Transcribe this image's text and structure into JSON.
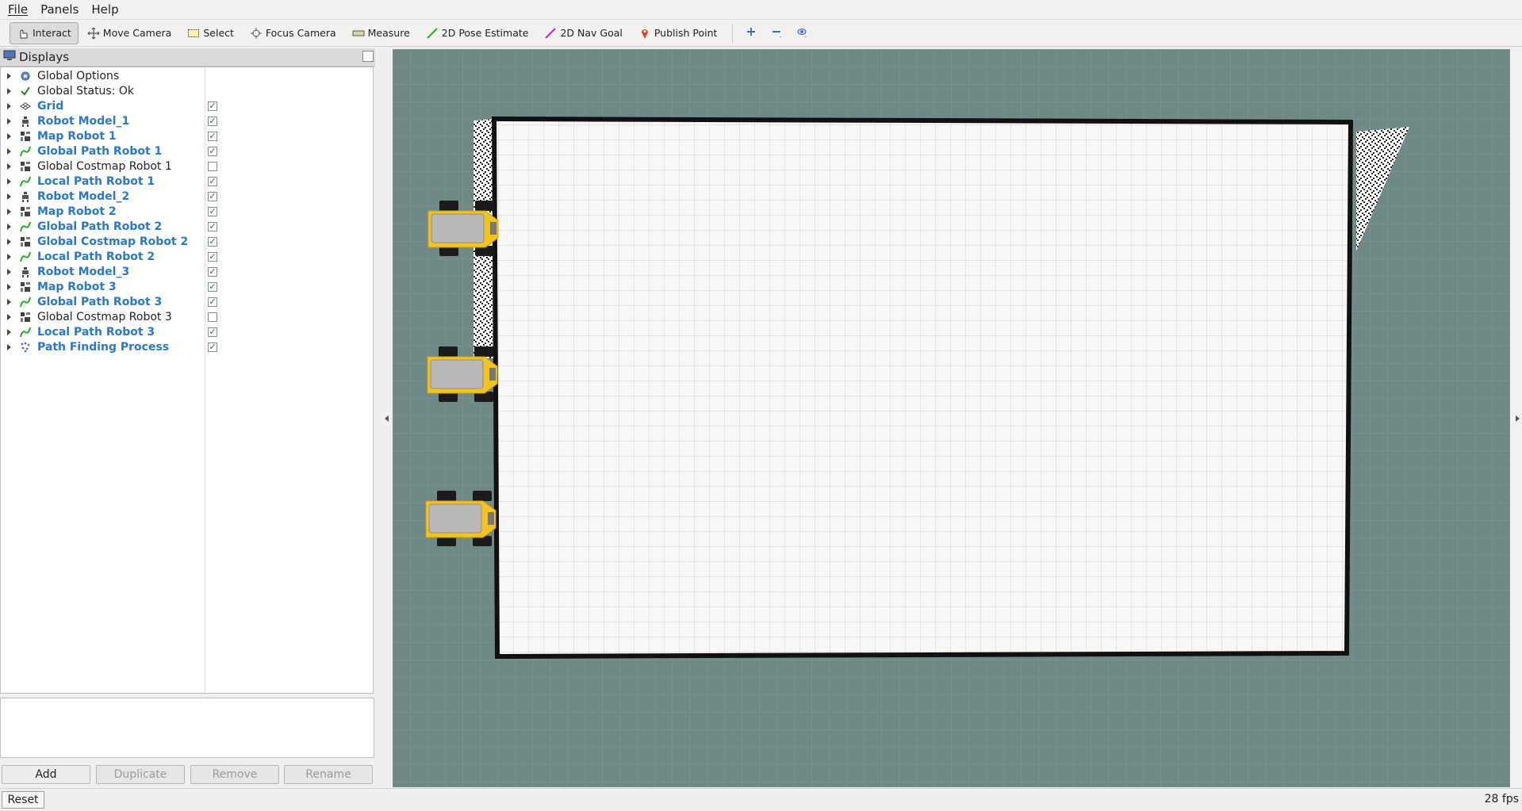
{
  "menu": [
    "File",
    "Panels",
    "Help"
  ],
  "toolbar": {
    "tools": [
      {
        "label": "Interact",
        "icon": "hand-icon",
        "active": true
      },
      {
        "label": "Move Camera",
        "icon": "move-camera-icon",
        "active": false
      },
      {
        "label": "Select",
        "icon": "select-icon",
        "active": false
      },
      {
        "label": "Focus Camera",
        "icon": "focus-camera-icon",
        "active": false
      },
      {
        "label": "Measure",
        "icon": "measure-icon",
        "active": false
      },
      {
        "label": "2D Pose Estimate",
        "icon": "pose-estimate-icon",
        "active": false
      },
      {
        "label": "2D Nav Goal",
        "icon": "nav-goal-icon",
        "active": false
      },
      {
        "label": "Publish Point",
        "icon": "publish-point-icon",
        "active": false
      }
    ],
    "small_tools": [
      "add-tool-icon",
      "remove-tool-icon",
      "camera-view-icon"
    ]
  },
  "displays": {
    "title": "Displays",
    "items": [
      {
        "label": "Global Options",
        "icon": "gear-icon",
        "bold": false,
        "checked": null
      },
      {
        "label": "Global Status: Ok",
        "icon": "checkmark-icon",
        "bold": false,
        "checked": null
      },
      {
        "label": "Grid",
        "icon": "grid-icon",
        "bold": true,
        "checked": true
      },
      {
        "label": "Robot Model_1",
        "icon": "robot-model-icon",
        "bold": true,
        "checked": true
      },
      {
        "label": "Map Robot 1",
        "icon": "map-icon",
        "bold": true,
        "checked": true
      },
      {
        "label": "Global Path Robot 1",
        "icon": "path-icon",
        "bold": true,
        "checked": true
      },
      {
        "label": "Global Costmap Robot 1",
        "icon": "map-icon",
        "bold": false,
        "checked": false
      },
      {
        "label": "Local Path Robot 1",
        "icon": "path-icon",
        "bold": true,
        "checked": true
      },
      {
        "label": "Robot Model_2",
        "icon": "robot-model-icon",
        "bold": true,
        "checked": true
      },
      {
        "label": "Map Robot 2",
        "icon": "map-icon",
        "bold": true,
        "checked": true
      },
      {
        "label": "Global Path Robot 2",
        "icon": "path-icon",
        "bold": true,
        "checked": true
      },
      {
        "label": "Global Costmap Robot 2",
        "icon": "map-icon",
        "bold": true,
        "checked": true
      },
      {
        "label": "Local Path Robot 2",
        "icon": "path-icon",
        "bold": true,
        "checked": true
      },
      {
        "label": "Robot Model_3",
        "icon": "robot-model-icon",
        "bold": true,
        "checked": true
      },
      {
        "label": "Map Robot 3",
        "icon": "map-icon",
        "bold": true,
        "checked": true
      },
      {
        "label": "Global Path Robot 3",
        "icon": "path-icon",
        "bold": true,
        "checked": true
      },
      {
        "label": "Global Costmap Robot 3",
        "icon": "map-icon",
        "bold": false,
        "checked": false
      },
      {
        "label": "Local Path Robot 3",
        "icon": "path-icon",
        "bold": true,
        "checked": true
      },
      {
        "label": "Path Finding Process",
        "icon": "marker-icon",
        "bold": true,
        "checked": true
      }
    ],
    "buttons": {
      "add": "Add",
      "duplicate": "Duplicate",
      "remove": "Remove",
      "rename": "Rename"
    }
  },
  "status": {
    "reset": "Reset",
    "fps": "28 fps"
  },
  "colors": {
    "bold_label": "#2a78c9",
    "viewport_bg": "#6f8a86",
    "robot_body": "#f3c41f",
    "path_green": "#22b022"
  }
}
